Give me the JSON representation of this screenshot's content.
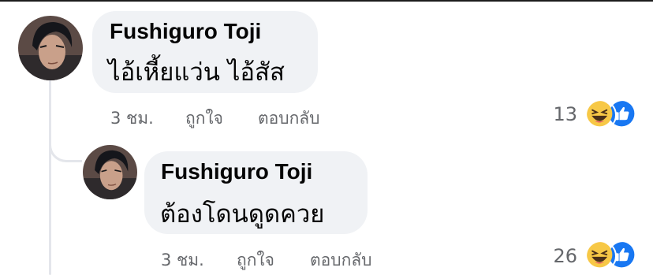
{
  "comment": {
    "author": "Fushiguro Toji",
    "text": "ไอ้เหี้ยแว่น ไอ้สัส",
    "time": "3 ชม.",
    "like_label": "ถูกใจ",
    "reply_label": "ตอบกลับ",
    "reaction_count": "13",
    "reactions": [
      "haha-icon",
      "like-icon"
    ]
  },
  "reply": {
    "author": "Fushiguro Toji",
    "text": "ต้องโดนดูดควย",
    "time": "3 ชม.",
    "like_label": "ถูกใจ",
    "reply_label": "ตอบกลับ",
    "reaction_count": "26",
    "reactions": [
      "haha-icon",
      "like-icon"
    ]
  },
  "colors": {
    "bubble": "#f0f2f5",
    "meta_text": "#65676b",
    "like_blue": "#1877f2",
    "haha_yellow": "#f7c846"
  }
}
